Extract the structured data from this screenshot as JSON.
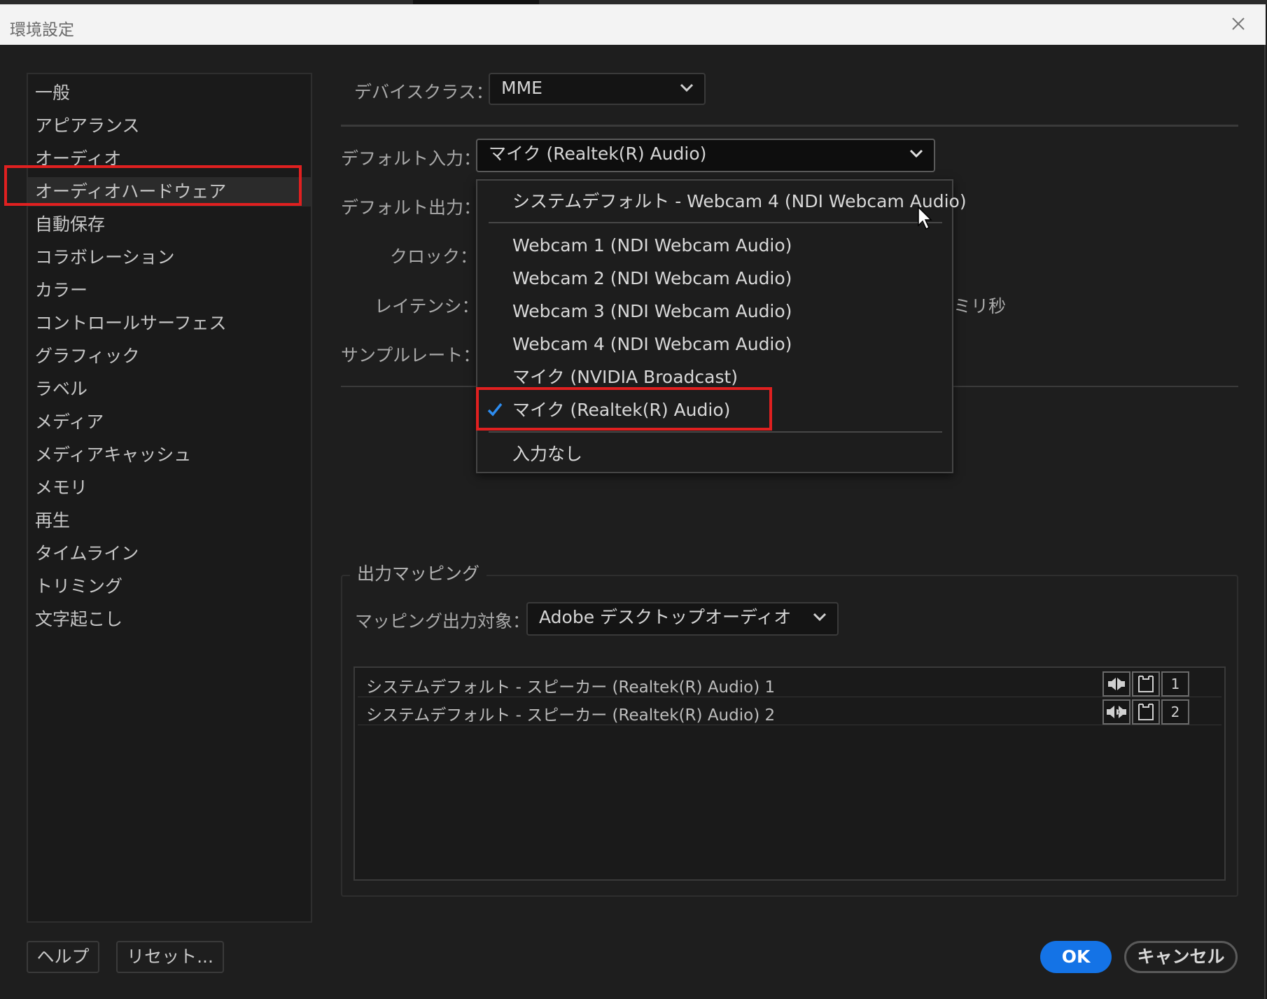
{
  "window": {
    "title": "環境設定"
  },
  "sidebar": {
    "items": [
      {
        "label": "一般"
      },
      {
        "label": "アピアランス"
      },
      {
        "label": "オーディオ"
      },
      {
        "label": "オーディオハードウェア",
        "selected": true
      },
      {
        "label": "自動保存"
      },
      {
        "label": "コラボレーション"
      },
      {
        "label": "カラー"
      },
      {
        "label": "コントロールサーフェス"
      },
      {
        "label": "グラフィック"
      },
      {
        "label": "ラベル"
      },
      {
        "label": "メディア"
      },
      {
        "label": "メディアキャッシュ"
      },
      {
        "label": "メモリ"
      },
      {
        "label": "再生"
      },
      {
        "label": "タイムライン"
      },
      {
        "label": "トリミング"
      },
      {
        "label": "文字起こし"
      }
    ]
  },
  "settings": {
    "device_class_label": "デバイスクラス：",
    "device_class_value": "MME",
    "default_input_label": "デフォルト入力：",
    "default_input_value": "マイク (Realtek(R) Audio)",
    "default_output_label": "デフォルト出力：",
    "clock_label": "クロック：",
    "latency_label": "レイテンシ：",
    "latency_unit": "ミリ秒",
    "sample_rate_label": "サンプルレート："
  },
  "dropdown": {
    "items": [
      {
        "label": "システムデフォルト - Webcam 4 (NDI Webcam Audio)"
      },
      {
        "label": "Webcam 1 (NDI Webcam Audio)"
      },
      {
        "label": "Webcam 2 (NDI Webcam Audio)"
      },
      {
        "label": "Webcam 3 (NDI Webcam Audio)"
      },
      {
        "label": "Webcam 4 (NDI Webcam Audio)"
      },
      {
        "label": "マイク (NVIDIA Broadcast)"
      },
      {
        "label": "マイク (Realtek(R) Audio)",
        "checked": true
      },
      {
        "label": "入力なし"
      }
    ]
  },
  "output_mapping": {
    "group_title": "出力マッピング",
    "target_label": "マッピング出力対象：",
    "target_value": "Adobe デスクトップオーディオ",
    "rows": [
      {
        "label": "システムデフォルト - スピーカー (Realtek(R) Audio) 1",
        "channel": "1"
      },
      {
        "label": "システムデフォルト - スピーカー (Realtek(R) Audio) 2",
        "channel": "2"
      }
    ]
  },
  "buttons": {
    "help": "ヘルプ",
    "reset": "リセット...",
    "ok": "OK",
    "cancel": "キャンセル"
  },
  "colors": {
    "accent": "#1473e6",
    "highlight_box": "#e02020",
    "check": "#2d8cf0"
  }
}
